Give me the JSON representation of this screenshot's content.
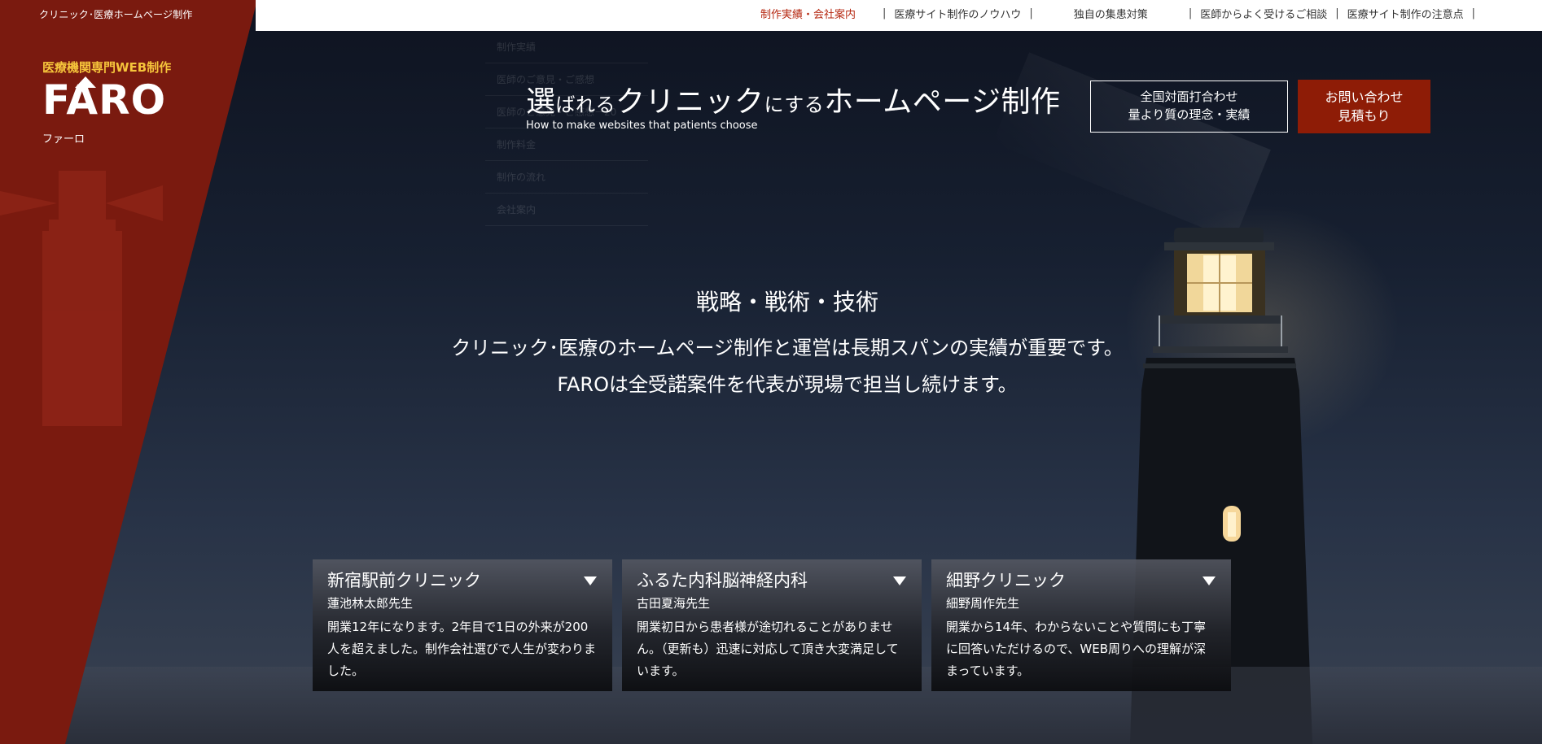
{
  "brand": {
    "tagline": "クリニック･医療ホームページ制作",
    "subtitle": "医療機関専門WEB制作",
    "logo": "FARO",
    "kana": "ファーロ"
  },
  "nav": {
    "items": [
      {
        "label": "制作実績・会社案内",
        "active": true
      },
      {
        "label": "医療サイト制作のノウハウ"
      },
      {
        "label": "独自の集患対策"
      },
      {
        "label": "医師からよく受けるご相談"
      },
      {
        "label": "医療サイト制作の注意点"
      }
    ],
    "separator": "|",
    "dropdown": [
      "制作実績",
      "医師のご意見・ご感想",
      "医師のご意見・ご感想－20",
      "制作料金",
      "制作の流れ",
      "会社案内"
    ]
  },
  "hero": {
    "headline": {
      "p1": "選",
      "p2": "ばれる",
      "p3": "クリニック",
      "p4": "にする",
      "p5": "ホームページ制作"
    },
    "headline_en": "How to make websites that patients choose",
    "cta_outline": {
      "line1": "全国対面打合わせ",
      "line2": "量より質の理念・実績"
    },
    "cta_solid": {
      "line1": "お問い合わせ",
      "line2": "見積もり"
    }
  },
  "message": {
    "line1": "戦略・戦術・技術",
    "line2": "クリニック･医療のホームページ制作と運営は長期スパンの実績が重要です。",
    "line3": "FAROは全受諾案件を代表が現場で担当し続けます。"
  },
  "testimonials": [
    {
      "clinic": "新宿駅前クリニック",
      "doctor": "蓮池林太郎先生",
      "text": "開業12年になります。2年目で1日の外来が200人を超えました。制作会社選びで人生が変わりました。"
    },
    {
      "clinic": "ふるた内科脳神経内科",
      "doctor": "古田夏海先生",
      "text": "開業初日から患者様が途切れることがありません。（更新も）迅速に対応して頂き大変満足しています。"
    },
    {
      "clinic": "細野クリニック",
      "doctor": "細野周作先生",
      "text": "開業から14年、わからないことや質問にも丁寧に回答いただけるので、WEB周りへの理解が深まっています。"
    }
  ],
  "colors": {
    "brand_red": "#7a1a0f",
    "cta_red": "#8e1c06",
    "accent_yellow": "#f5c43b",
    "nav_active": "#b5260f"
  },
  "icons": {
    "card_toggle": "triangle-down-icon",
    "logo_mark": "lighthouse-roof-icon"
  }
}
